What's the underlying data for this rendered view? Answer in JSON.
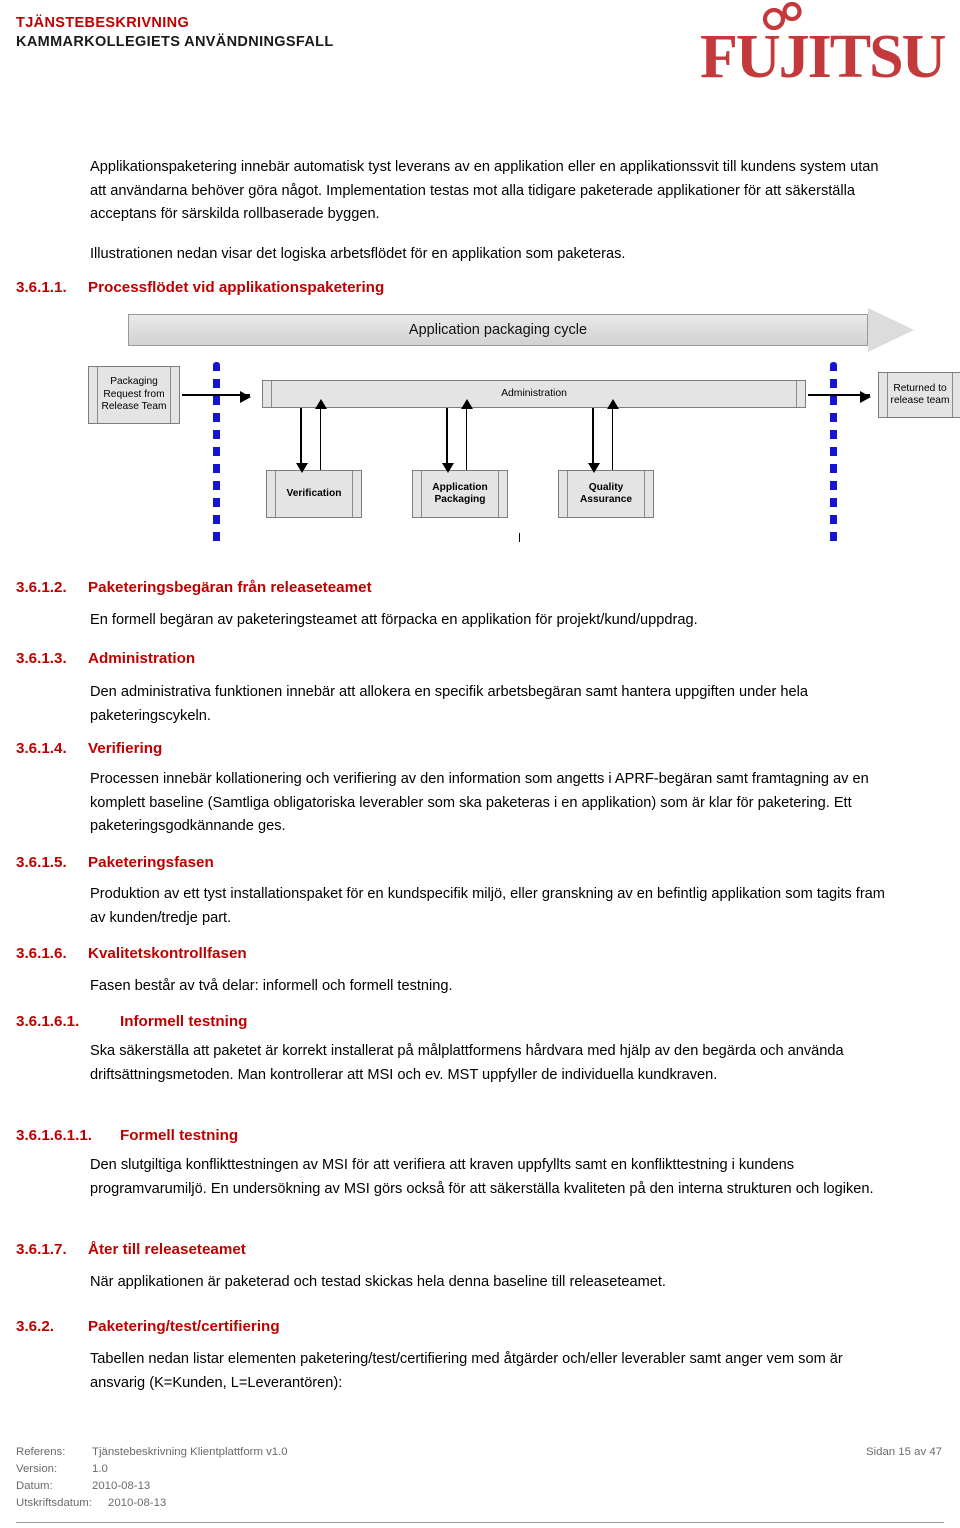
{
  "header": {
    "line1": "TJÄNSTEBESKRIVNING",
    "line2": "KAMMARKOLLEGIETS ANVÄNDNINGSFALL",
    "logo_text": "FUJITSU",
    "logo_color": "#C3393C",
    "heading_color": "#C00000"
  },
  "intro": {
    "paragraph1": "Applikationspaketering innebär automatisk tyst leverans av en applikation eller en applikationssvit till kundens system utan att användarna behöver göra något. Implementation testas mot alla tidigare paketerade applikationer för att säkerställa acceptans för särskilda rollbaserade byggen.",
    "paragraph2": "Illustrationen nedan visar det logiska arbetsflödet för en applikation som paketeras."
  },
  "diagram": {
    "banner_label": "Application packaging cycle",
    "box_request": "Packaging Request from Release Team",
    "box_admin": "Administration",
    "box_returned": "Returned to release team",
    "box_verification": "Verification",
    "box_packaging": "Application Packaging",
    "box_quality": "Quality Assurance",
    "dotted_line_color": "#1414D2",
    "box_fill_color": "#E4E4E4"
  },
  "sections": [
    {
      "number": "3.6.1.1.",
      "title": "Processflödet vid applikationspaketering",
      "body": ""
    },
    {
      "number": "3.6.1.2.",
      "title": "Paketeringsbegäran från releaseteamet",
      "body": "En formell begäran av paketeringsteamet att förpacka en applikation för projekt/kund/uppdrag."
    },
    {
      "number": "3.6.1.3.",
      "title": "Administration",
      "body": "Den administrativa funktionen innebär att allokera en specifik arbetsbegäran samt hantera uppgiften under hela paketeringscykeln."
    },
    {
      "number": "3.6.1.4.",
      "title": "Verifiering",
      "body": "Processen innebär kollationering och verifiering av den information som angetts i APRF-begäran samt framtagning av en komplett baseline (Samtliga obligatoriska leverabler som ska paketeras i en applikation) som är klar för paketering. Ett paketeringsgodkännande ges."
    },
    {
      "number": "3.6.1.5.",
      "title": "Paketeringsfasen",
      "body": "Produktion av ett tyst installationspaket för en kundspecifik miljö, eller granskning av en befintlig applikation som tagits fram av kunden/tredje part."
    },
    {
      "number": "3.6.1.6.",
      "title": "Kvalitetskontrollfasen",
      "body": "Fasen består av två delar: informell och formell testning."
    },
    {
      "number": "3.6.1.6.1.",
      "title": "Informell testning",
      "body": "Ska säkerställa att paketet är korrekt installerat på målplattformens hårdvara med hjälp av den begärda och använda driftsättningsmetoden. Man kontrollerar att MSI och ev. MST uppfyller de individuella kundkraven."
    },
    {
      "number": "3.6.1.6.1.1.",
      "title": "Formell testning",
      "body": "Den slutgiltiga konflikttestningen av MSI för att verifiera att kraven uppfyllts samt en konflikttestning i kundens programvarumiljö. En undersökning av MSI görs också för att säkerställa kvaliteten på den interna strukturen och logiken."
    },
    {
      "number": "3.6.1.7.",
      "title": "Åter till releaseteamet",
      "body": "När applikationen är paketerad och testad skickas hela denna baseline till releaseteamet."
    },
    {
      "number": "3.6.2.",
      "title": "Paketering/test/certifiering",
      "body": "Tabellen nedan listar elementen paketering/test/certifiering med åtgärder och/eller leverabler samt anger vem som är ansvarig (K=Kunden, L=Leverantören):"
    }
  ],
  "footer": {
    "label_reference": "Referens:",
    "value_reference": "Tjänstebeskrivning Klientplattform v1.0",
    "label_version": "Version:",
    "value_version": "1.0",
    "label_date": "Datum:",
    "value_date": "2010-08-13",
    "label_printdate": "Utskriftsdatum:",
    "value_printdate": "2010-08-13",
    "page": "Sidan 15 av 47"
  }
}
